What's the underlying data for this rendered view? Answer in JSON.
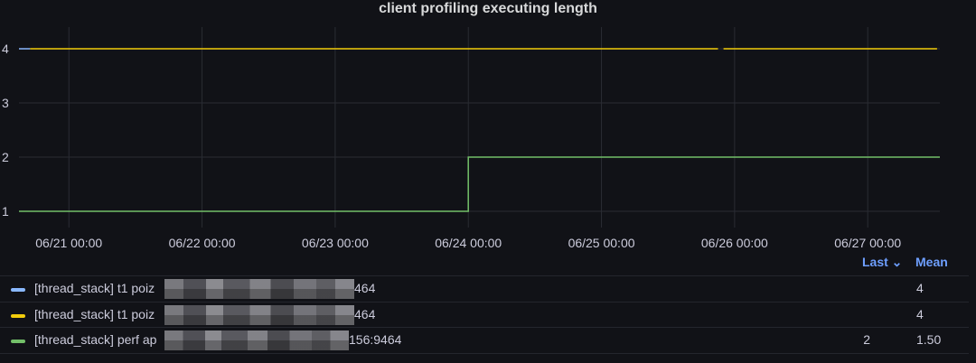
{
  "panel": {
    "title": "client profiling executing length"
  },
  "colors": {
    "background": "#111217",
    "grid": "#2a2c33",
    "axis_text": "#ccccdc",
    "legend_header": "#6e9fff",
    "series_blue": "#8ab8ff",
    "series_yellow": "#f2cc0c",
    "series_green": "#73bf69"
  },
  "chart_data": {
    "type": "line",
    "title": "client profiling executing length",
    "xlabel": "",
    "ylabel": "",
    "x_ticks": [
      "06/21 00:00",
      "06/22 00:00",
      "06/23 00:00",
      "06/24 00:00",
      "06/25 00:00",
      "06/26 00:00",
      "06/27 00:00"
    ],
    "y_ticks": [
      1,
      2,
      3,
      4
    ],
    "xlim": [
      "06/20 15:00",
      "06/27 13:00"
    ],
    "ylim": [
      0.7,
      4.4
    ],
    "grid": true,
    "legend_placement": "bottom",
    "series": [
      {
        "color": "#8ab8ff",
        "points": [
          [
            "06/20 15:00",
            4
          ],
          [
            "06/20 17:00",
            4
          ]
        ]
      },
      {
        "color": "#f2cc0c",
        "points": [
          [
            "06/20 17:00",
            4
          ],
          [
            "06/25 21:00",
            4
          ],
          null,
          [
            "06/25 22:00",
            4
          ],
          [
            "06/27 12:30",
            4
          ]
        ]
      },
      {
        "color": "#73bf69",
        "points": [
          [
            "06/20 15:00",
            1
          ],
          [
            "06/24 00:00",
            1
          ],
          [
            "06/24 00:00",
            2
          ],
          [
            "06/27 13:00",
            2
          ]
        ]
      }
    ]
  },
  "legend": {
    "header_last": "Last ⌄",
    "header_mean": "Mean",
    "rows": [
      {
        "prefix": "[thread_stack] t1 poiz",
        "suffix": "464",
        "color": "#8ab8ff",
        "last": "",
        "mean": "4"
      },
      {
        "prefix": "[thread_stack] t1 poiz",
        "suffix": "464",
        "color": "#f2cc0c",
        "last": "",
        "mean": "4"
      },
      {
        "prefix": "[thread_stack] perf ap",
        "suffix": "156:9464",
        "color": "#73bf69",
        "last": "2",
        "mean": "1.50"
      }
    ]
  }
}
